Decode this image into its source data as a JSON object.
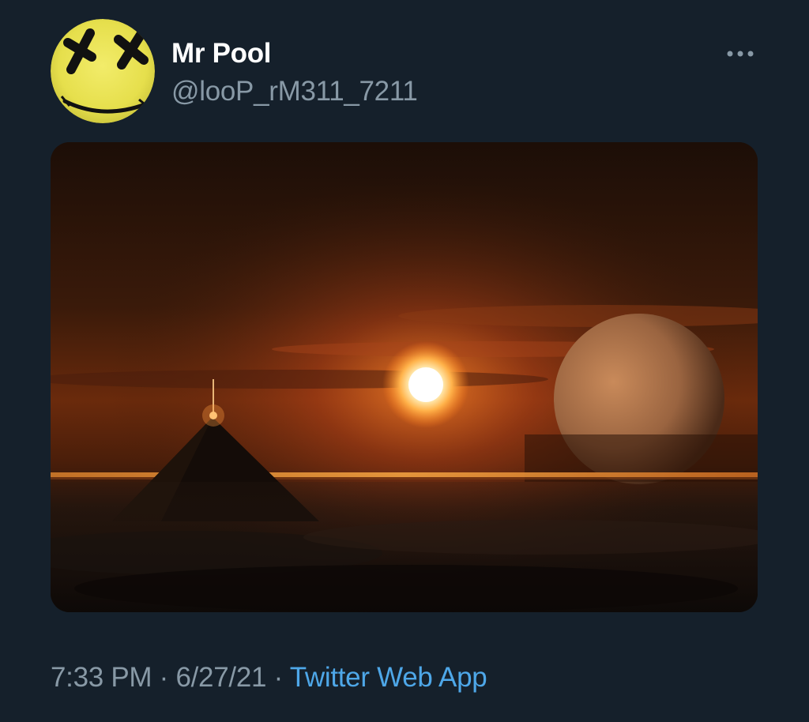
{
  "author": {
    "display_name": "Mr Pool",
    "handle": "@looP_rM311_7211",
    "avatar_icon": "yellow-smiley-face-with-x-eyes"
  },
  "more_icon": "ellipsis-icon",
  "media": {
    "icon": "pyramid-sun-planet-artwork"
  },
  "meta": {
    "time": "7:33 PM",
    "separator": " · ",
    "date": "6/27/21",
    "separator2": " · ",
    "source": "Twitter Web App"
  },
  "colors": {
    "background": "#15202b",
    "text_primary": "#ffffff",
    "text_secondary": "#8899a6",
    "link": "#4ea7e8"
  }
}
